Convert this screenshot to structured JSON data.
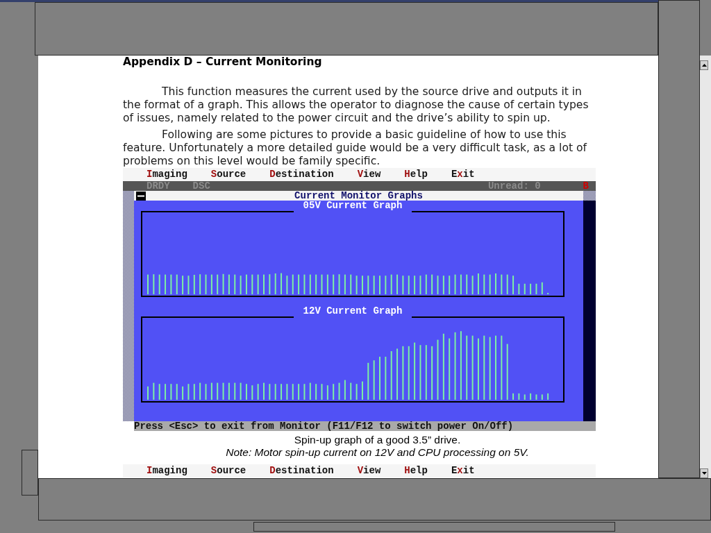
{
  "document": {
    "heading": "Appendix D – Current Monitoring",
    "paragraphs": [
      "This function measures the current used by the source drive and outputs it in the format of a graph. This allows the operator to diagnose the cause of certain types of issues, namely related to the power circuit and the drive’s ability to spin up.",
      "Following are some pictures to provide a basic guideline of how to use this feature. Unfortunately a more detailed guide would be a very difficult task, as a lot of problems on this level would be family specific."
    ],
    "figures": [
      {
        "menu": [
          {
            "hotkey": "I",
            "after": "maging"
          },
          {
            "hotkey": "S",
            "after": "ource"
          },
          {
            "hotkey": "D",
            "after": "estination"
          },
          {
            "hotkey": "V",
            "after": "iew"
          },
          {
            "hotkey": "H",
            "after": "elp"
          },
          {
            "before": "E",
            "hotkey": "x",
            "after": "it"
          }
        ],
        "status_line": {
          "left": [
            {
              "text": "DRDY",
              "kind": "label"
            },
            {
              "text": "DSC",
              "kind": "label"
            }
          ],
          "right": [
            {
              "text": "Unread: 0",
              "kind": "label"
            },
            {
              "text": "B",
              "kind": "alert"
            }
          ]
        },
        "window": {
          "title": "Current Monitor Graphs",
          "graphs": [
            {
              "title": "05V Current Graph"
            },
            {
              "title": "12V Current Graph"
            }
          ]
        },
        "footer": "Press <Esc> to exit from Monitor (F11/F12 to switch power On/Off)",
        "caption": "Spin-up graph of a good 3.5” drive.",
        "note": "Note: Motor spin-up current on 12V and CPU processing on 5V."
      },
      {
        "menu": [
          {
            "hotkey": "I",
            "after": "maging"
          },
          {
            "hotkey": "S",
            "after": "ource"
          },
          {
            "hotkey": "D",
            "after": "estination"
          },
          {
            "hotkey": "V",
            "after": "iew"
          },
          {
            "hotkey": "H",
            "after": "elp"
          },
          {
            "before": "E",
            "hotkey": "x",
            "after": "it"
          }
        ]
      }
    ]
  }
}
